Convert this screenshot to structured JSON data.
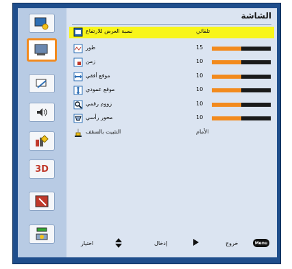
{
  "menu": {
    "title": "الشاشة"
  },
  "sidebar": {
    "items": [
      {
        "icon": "picture-icon"
      },
      {
        "icon": "display-icon"
      },
      {
        "icon": "setup-icon"
      },
      {
        "icon": "volume-icon"
      },
      {
        "icon": "options-icon"
      },
      {
        "icon": "3d-icon",
        "text": "3D"
      },
      {
        "icon": "lamp-icon"
      },
      {
        "icon": "network-icon"
      }
    ]
  },
  "rows": [
    {
      "label": "نسبة العرض للارتفاع",
      "value": "تلقائي",
      "icon": "aspect-ratio-icon",
      "highlighted": true
    },
    {
      "label": "طور",
      "value": "15",
      "icon": "phase-icon",
      "level": 0.5
    },
    {
      "label": "زمن",
      "value": "10",
      "icon": "clock-icon",
      "level": 0.5
    },
    {
      "label": "موقع أفقي",
      "value": "10",
      "icon": "h-position-icon",
      "level": 0.5
    },
    {
      "label": "موقع عمودي",
      "value": "10",
      "icon": "v-position-icon",
      "level": 0.5
    },
    {
      "label": "زووم رقمي",
      "value": "10",
      "icon": "zoom-icon",
      "level": 0.5
    },
    {
      "label": "محور رأسي",
      "value": "10",
      "icon": "keystone-icon",
      "level": 0.5
    },
    {
      "label": "التثبيت بالسقف",
      "value": "الأمام",
      "icon": "ceiling-mount-icon"
    }
  ],
  "footer": {
    "select_label": "اختيار",
    "enter_label": "إدخال",
    "exit_label": "خروج",
    "menu_key": "Menu"
  },
  "colors": {
    "accent": "#f28a1d",
    "highlight": "#f8f51a",
    "frame": "#1f4e8c"
  }
}
